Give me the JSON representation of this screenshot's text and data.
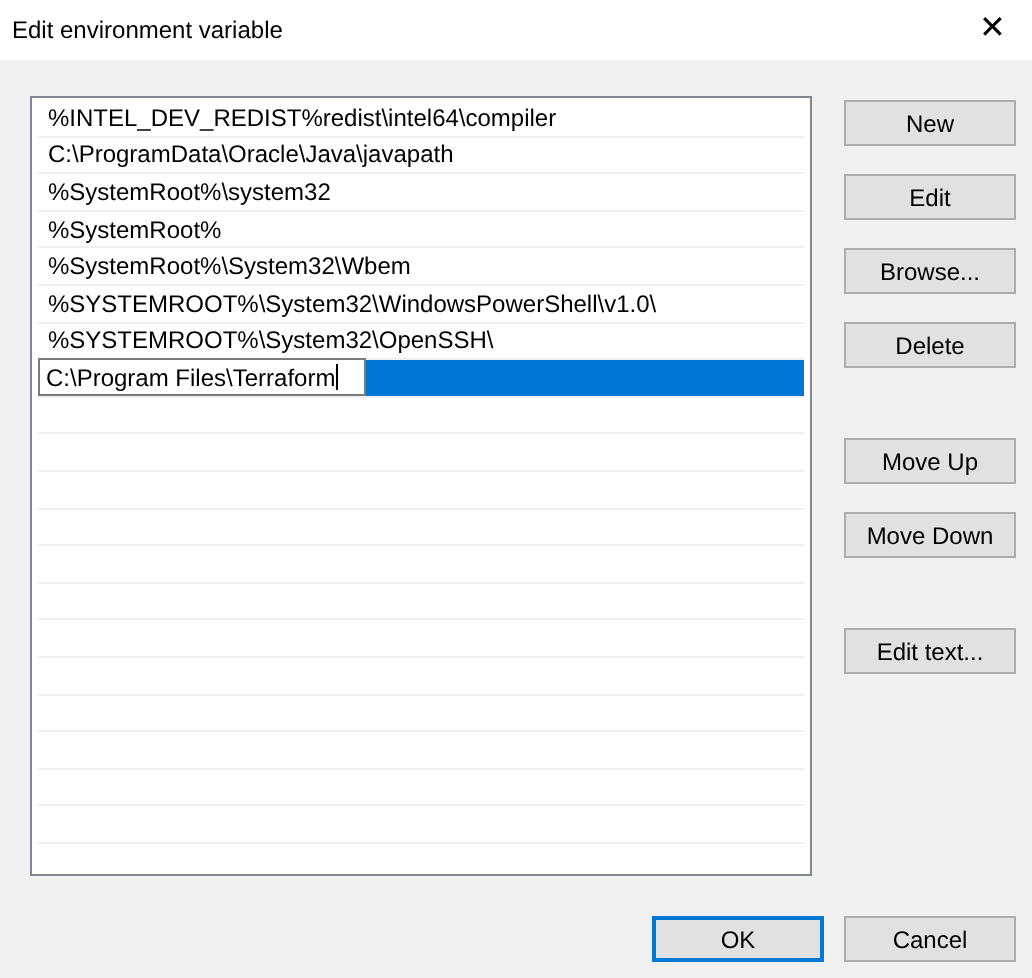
{
  "window": {
    "title": "Edit environment variable",
    "close": "✕"
  },
  "entries": [
    {
      "text": "%INTEL_DEV_REDIST%redist\\intel64\\compiler",
      "selected": false,
      "kind": "text"
    },
    {
      "text": "C:\\ProgramData\\Oracle\\Java\\javapath",
      "selected": false,
      "kind": "text"
    },
    {
      "text": "%SystemRoot%\\system32",
      "selected": false,
      "kind": "text"
    },
    {
      "text": "%SystemRoot%",
      "selected": false,
      "kind": "text"
    },
    {
      "text": "%SystemRoot%\\System32\\Wbem",
      "selected": false,
      "kind": "text"
    },
    {
      "text": "%SYSTEMROOT%\\System32\\WindowsPowerShell\\v1.0\\",
      "selected": false,
      "kind": "text"
    },
    {
      "text": "%SYSTEMROOT%\\System32\\OpenSSH\\",
      "selected": false,
      "kind": "text"
    },
    {
      "text": "C:\\Program Files\\Terraform",
      "selected": true,
      "kind": "editing"
    }
  ],
  "side_button_groups": [
    [
      "New",
      "Edit",
      "Browse...",
      "Delete"
    ],
    [
      "Move Up",
      "Move Down"
    ],
    [
      "Edit text..."
    ]
  ],
  "footer_buttons": [
    {
      "label": "OK",
      "default": true
    },
    {
      "label": "Cancel",
      "default": false
    }
  ]
}
